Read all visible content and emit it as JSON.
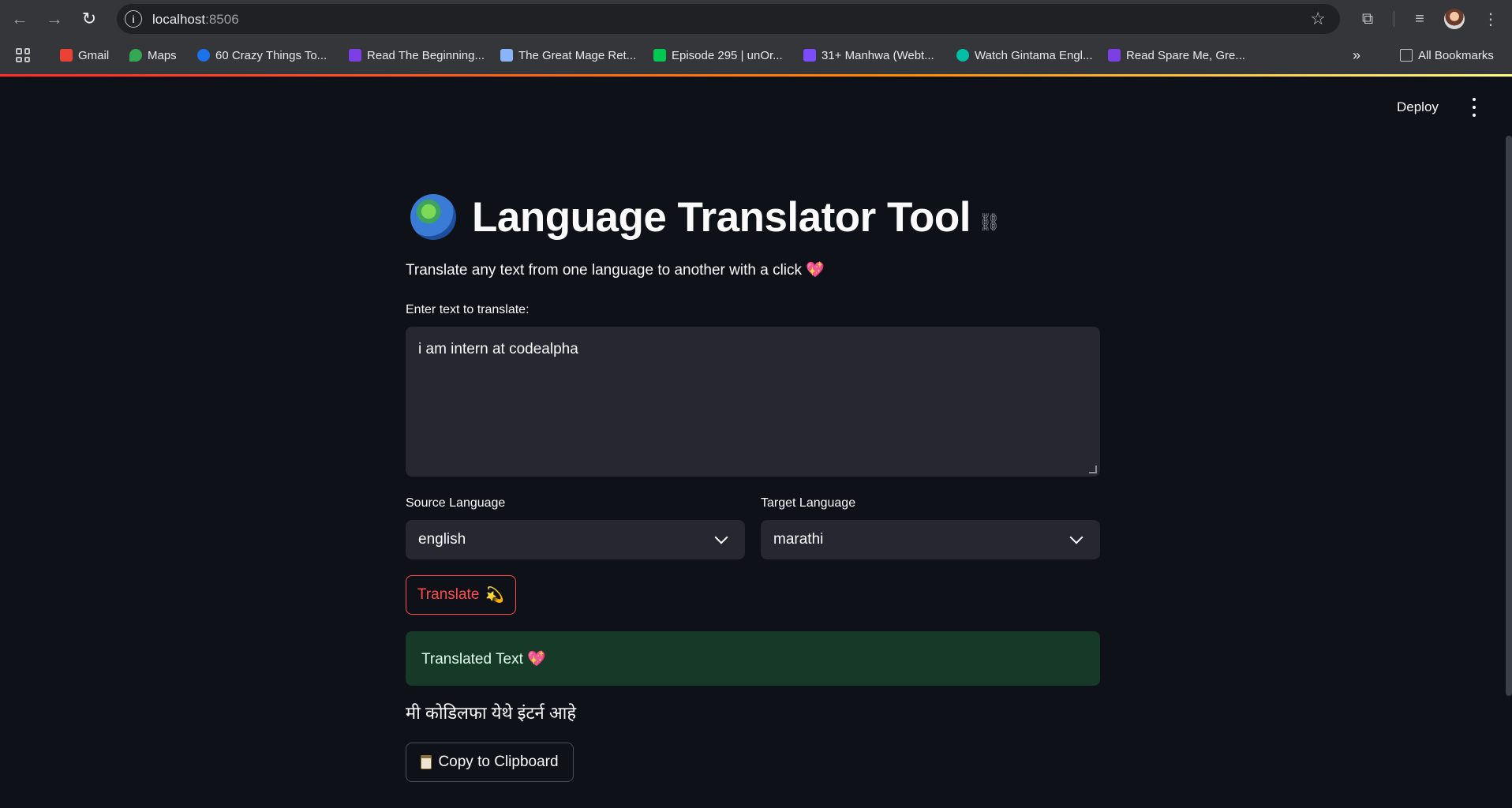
{
  "browser": {
    "url_host": "localhost",
    "url_port": ":8506",
    "bookmarks": [
      {
        "label": "Gmail",
        "color": "#ea4335"
      },
      {
        "label": "Maps",
        "color": "#34a853"
      },
      {
        "label": "60 Crazy Things To...",
        "color": "#1a73e8"
      },
      {
        "label": "Read The Beginning...",
        "color": "#7b3fe4"
      },
      {
        "label": "The Great Mage Ret...",
        "color": "#8ab4f8"
      },
      {
        "label": "Episode 295 | unOr...",
        "color": "#00c853"
      },
      {
        "label": "31+ Manhwa (Webt...",
        "color": "#7c4dff"
      },
      {
        "label": "Watch Gintama Engl...",
        "color": "#00bfa5"
      },
      {
        "label": "Read Spare Me, Gre...",
        "color": "#7b3fe4"
      }
    ],
    "all_bookmarks": "All Bookmarks"
  },
  "app": {
    "deploy": "Deploy",
    "title": "Language Translator Tool",
    "subtitle": "Translate any text from one language to another with a click 💖",
    "input_label": "Enter text to translate:",
    "input_value": "i am intern at codealpha",
    "source_label": "Source Language",
    "source_value": "english",
    "target_label": "Target Language",
    "target_value": "marathi",
    "translate_button": "Translate",
    "translate_emoji": "💫",
    "result_header": "Translated Text 💖",
    "translated_text": "मी कोडिलफा येथे इंटर्न आहे",
    "copy_button": "Copy to Clipboard"
  }
}
